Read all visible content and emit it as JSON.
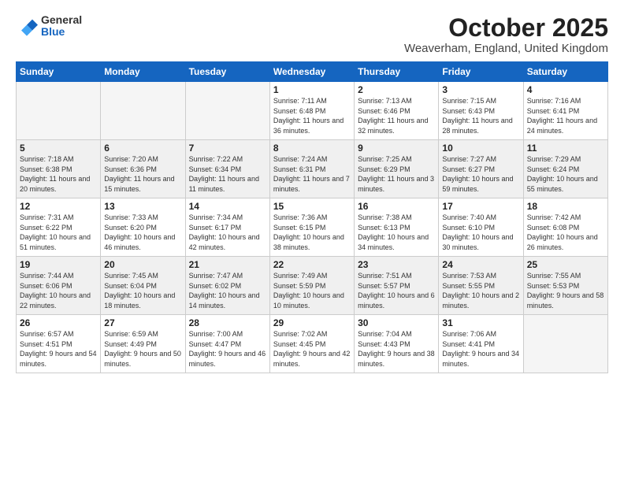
{
  "logo": {
    "general": "General",
    "blue": "Blue"
  },
  "title": "October 2025",
  "subtitle": "Weaverham, England, United Kingdom",
  "weekdays": [
    "Sunday",
    "Monday",
    "Tuesday",
    "Wednesday",
    "Thursday",
    "Friday",
    "Saturday"
  ],
  "weeks": [
    [
      {
        "day": "",
        "empty": true
      },
      {
        "day": "",
        "empty": true
      },
      {
        "day": "",
        "empty": true
      },
      {
        "day": "1",
        "sunrise": "7:11 AM",
        "sunset": "6:48 PM",
        "daylight": "11 hours and 36 minutes."
      },
      {
        "day": "2",
        "sunrise": "7:13 AM",
        "sunset": "6:46 PM",
        "daylight": "11 hours and 32 minutes."
      },
      {
        "day": "3",
        "sunrise": "7:15 AM",
        "sunset": "6:43 PM",
        "daylight": "11 hours and 28 minutes."
      },
      {
        "day": "4",
        "sunrise": "7:16 AM",
        "sunset": "6:41 PM",
        "daylight": "11 hours and 24 minutes."
      }
    ],
    [
      {
        "day": "5",
        "sunrise": "7:18 AM",
        "sunset": "6:38 PM",
        "daylight": "11 hours and 20 minutes."
      },
      {
        "day": "6",
        "sunrise": "7:20 AM",
        "sunset": "6:36 PM",
        "daylight": "11 hours and 15 minutes."
      },
      {
        "day": "7",
        "sunrise": "7:22 AM",
        "sunset": "6:34 PM",
        "daylight": "11 hours and 11 minutes."
      },
      {
        "day": "8",
        "sunrise": "7:24 AM",
        "sunset": "6:31 PM",
        "daylight": "11 hours and 7 minutes."
      },
      {
        "day": "9",
        "sunrise": "7:25 AM",
        "sunset": "6:29 PM",
        "daylight": "11 hours and 3 minutes."
      },
      {
        "day": "10",
        "sunrise": "7:27 AM",
        "sunset": "6:27 PM",
        "daylight": "10 hours and 59 minutes."
      },
      {
        "day": "11",
        "sunrise": "7:29 AM",
        "sunset": "6:24 PM",
        "daylight": "10 hours and 55 minutes."
      }
    ],
    [
      {
        "day": "12",
        "sunrise": "7:31 AM",
        "sunset": "6:22 PM",
        "daylight": "10 hours and 51 minutes."
      },
      {
        "day": "13",
        "sunrise": "7:33 AM",
        "sunset": "6:20 PM",
        "daylight": "10 hours and 46 minutes."
      },
      {
        "day": "14",
        "sunrise": "7:34 AM",
        "sunset": "6:17 PM",
        "daylight": "10 hours and 42 minutes."
      },
      {
        "day": "15",
        "sunrise": "7:36 AM",
        "sunset": "6:15 PM",
        "daylight": "10 hours and 38 minutes."
      },
      {
        "day": "16",
        "sunrise": "7:38 AM",
        "sunset": "6:13 PM",
        "daylight": "10 hours and 34 minutes."
      },
      {
        "day": "17",
        "sunrise": "7:40 AM",
        "sunset": "6:10 PM",
        "daylight": "10 hours and 30 minutes."
      },
      {
        "day": "18",
        "sunrise": "7:42 AM",
        "sunset": "6:08 PM",
        "daylight": "10 hours and 26 minutes."
      }
    ],
    [
      {
        "day": "19",
        "sunrise": "7:44 AM",
        "sunset": "6:06 PM",
        "daylight": "10 hours and 22 minutes."
      },
      {
        "day": "20",
        "sunrise": "7:45 AM",
        "sunset": "6:04 PM",
        "daylight": "10 hours and 18 minutes."
      },
      {
        "day": "21",
        "sunrise": "7:47 AM",
        "sunset": "6:02 PM",
        "daylight": "10 hours and 14 minutes."
      },
      {
        "day": "22",
        "sunrise": "7:49 AM",
        "sunset": "5:59 PM",
        "daylight": "10 hours and 10 minutes."
      },
      {
        "day": "23",
        "sunrise": "7:51 AM",
        "sunset": "5:57 PM",
        "daylight": "10 hours and 6 minutes."
      },
      {
        "day": "24",
        "sunrise": "7:53 AM",
        "sunset": "5:55 PM",
        "daylight": "10 hours and 2 minutes."
      },
      {
        "day": "25",
        "sunrise": "7:55 AM",
        "sunset": "5:53 PM",
        "daylight": "9 hours and 58 minutes."
      }
    ],
    [
      {
        "day": "26",
        "sunrise": "6:57 AM",
        "sunset": "4:51 PM",
        "daylight": "9 hours and 54 minutes."
      },
      {
        "day": "27",
        "sunrise": "6:59 AM",
        "sunset": "4:49 PM",
        "daylight": "9 hours and 50 minutes."
      },
      {
        "day": "28",
        "sunrise": "7:00 AM",
        "sunset": "4:47 PM",
        "daylight": "9 hours and 46 minutes."
      },
      {
        "day": "29",
        "sunrise": "7:02 AM",
        "sunset": "4:45 PM",
        "daylight": "9 hours and 42 minutes."
      },
      {
        "day": "30",
        "sunrise": "7:04 AM",
        "sunset": "4:43 PM",
        "daylight": "9 hours and 38 minutes."
      },
      {
        "day": "31",
        "sunrise": "7:06 AM",
        "sunset": "4:41 PM",
        "daylight": "9 hours and 34 minutes."
      },
      {
        "day": "",
        "empty": true
      }
    ]
  ]
}
